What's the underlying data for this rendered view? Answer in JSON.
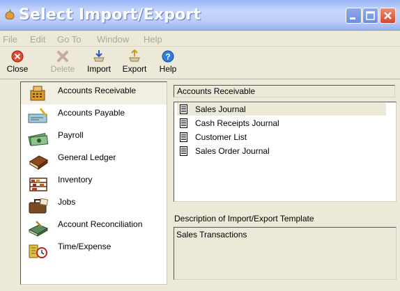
{
  "window": {
    "title": "Select Import/Export",
    "controls": [
      "minimize-icon",
      "maximize-icon",
      "close-icon"
    ]
  },
  "menu": [
    "File",
    "Edit",
    "Go To",
    "Window",
    "Help"
  ],
  "toolbar": {
    "close": "Close",
    "delete": "Delete",
    "import": "Import",
    "export": "Export",
    "help": "Help"
  },
  "modules": [
    {
      "label": "Accounts Receivable",
      "icon": "register-icon",
      "selected": true
    },
    {
      "label": "Accounts Payable",
      "icon": "checkbook-icon",
      "selected": false
    },
    {
      "label": "Payroll",
      "icon": "money-icon",
      "selected": false
    },
    {
      "label": "General Ledger",
      "icon": "ledger-book-icon",
      "selected": false
    },
    {
      "label": "Inventory",
      "icon": "inventory-shelves-icon",
      "selected": false
    },
    {
      "label": "Jobs",
      "icon": "briefcase-icon",
      "selected": false
    },
    {
      "label": "Account Reconciliation",
      "icon": "reconcile-icon",
      "selected": false
    },
    {
      "label": "Time/Expense",
      "icon": "clock-icon",
      "selected": false
    }
  ],
  "templates": {
    "title": "Accounts Receivable",
    "items": [
      {
        "label": "Sales Journal",
        "selected": true
      },
      {
        "label": "Cash Receipts Journal",
        "selected": false
      },
      {
        "label": "Customer List",
        "selected": false
      },
      {
        "label": "Sales Order Journal",
        "selected": false
      }
    ]
  },
  "description": {
    "label": "Description of Import/Export Template",
    "value": "Sales Transactions"
  },
  "colors": {
    "titlebar": "#97b4f5",
    "window_bg": "#ece9d8",
    "close_button": "#d7462c"
  }
}
